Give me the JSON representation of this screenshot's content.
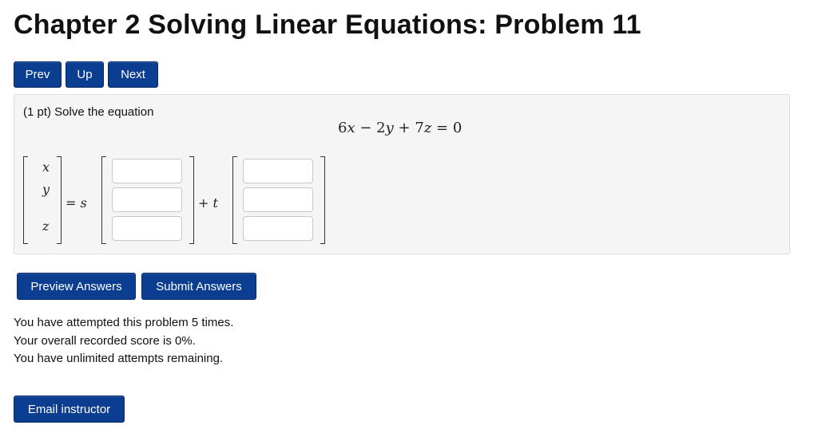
{
  "page": {
    "title": "Chapter 2 Solving Linear Equations: Problem 11"
  },
  "nav": {
    "prev_label": "Prev",
    "up_label": "Up",
    "next_label": "Next"
  },
  "problem": {
    "prompt": "(1 pt) Solve the equation",
    "equation": {
      "a": "6",
      "x": "x",
      "op1": "−",
      "b": "2",
      "y": "y",
      "op2": "+",
      "c": "7",
      "z": "z",
      "eq": "=",
      "rhs": "0"
    },
    "vector_vars": [
      "x",
      "y",
      "z"
    ],
    "equals_s": {
      "eq": "=",
      "s": "s"
    },
    "plus_t": {
      "plus": "+",
      "t": "t"
    },
    "answers_s": [
      "",
      "",
      ""
    ],
    "answers_t": [
      "",
      "",
      ""
    ]
  },
  "actions": {
    "preview_label": "Preview Answers",
    "submit_label": "Submit Answers"
  },
  "status": {
    "line1": "You have attempted this problem 5 times.",
    "line2": "Your overall recorded score is 0%.",
    "line3": "You have unlimited attempts remaining."
  },
  "footer": {
    "email_label": "Email instructor"
  },
  "colors": {
    "button_bg": "#0b3d91",
    "panel_bg": "#f5f5f5"
  }
}
